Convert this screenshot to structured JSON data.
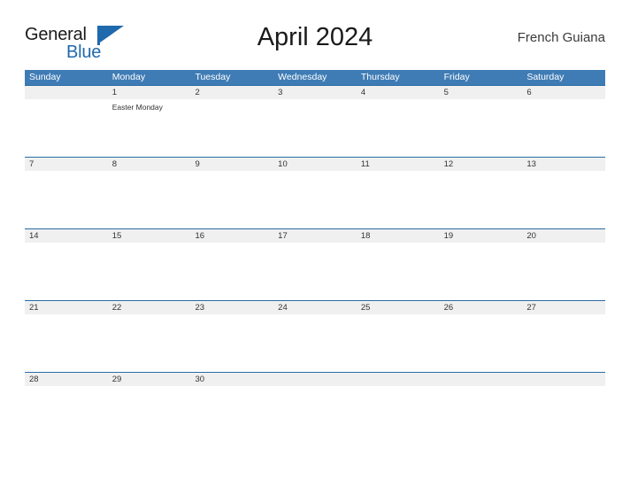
{
  "brand": {
    "name_part1": "General",
    "name_part2": "Blue",
    "flag_icon": "flag-triangle-icon",
    "color_primary": "#1f69ad",
    "color_text": "#1a1a1a"
  },
  "header": {
    "title": "April 2024",
    "locale": "French Guiana"
  },
  "calendar": {
    "accent_color": "#3f7cb5",
    "separator_color": "#2b6ca3",
    "date_band_color": "#f0f0f0",
    "weekdays": [
      "Sunday",
      "Monday",
      "Tuesday",
      "Wednesday",
      "Thursday",
      "Friday",
      "Saturday"
    ],
    "weeks": [
      {
        "days": [
          {
            "date": "",
            "events": []
          },
          {
            "date": "1",
            "events": [
              "Easter Monday"
            ]
          },
          {
            "date": "2",
            "events": []
          },
          {
            "date": "3",
            "events": []
          },
          {
            "date": "4",
            "events": []
          },
          {
            "date": "5",
            "events": []
          },
          {
            "date": "6",
            "events": []
          }
        ]
      },
      {
        "days": [
          {
            "date": "7",
            "events": []
          },
          {
            "date": "8",
            "events": []
          },
          {
            "date": "9",
            "events": []
          },
          {
            "date": "10",
            "events": []
          },
          {
            "date": "11",
            "events": []
          },
          {
            "date": "12",
            "events": []
          },
          {
            "date": "13",
            "events": []
          }
        ]
      },
      {
        "days": [
          {
            "date": "14",
            "events": []
          },
          {
            "date": "15",
            "events": []
          },
          {
            "date": "16",
            "events": []
          },
          {
            "date": "17",
            "events": []
          },
          {
            "date": "18",
            "events": []
          },
          {
            "date": "19",
            "events": []
          },
          {
            "date": "20",
            "events": []
          }
        ]
      },
      {
        "days": [
          {
            "date": "21",
            "events": []
          },
          {
            "date": "22",
            "events": []
          },
          {
            "date": "23",
            "events": []
          },
          {
            "date": "24",
            "events": []
          },
          {
            "date": "25",
            "events": []
          },
          {
            "date": "26",
            "events": []
          },
          {
            "date": "27",
            "events": []
          }
        ]
      },
      {
        "days": [
          {
            "date": "28",
            "events": []
          },
          {
            "date": "29",
            "events": []
          },
          {
            "date": "30",
            "events": []
          },
          {
            "date": "",
            "events": []
          },
          {
            "date": "",
            "events": []
          },
          {
            "date": "",
            "events": []
          },
          {
            "date": "",
            "events": []
          }
        ]
      }
    ]
  }
}
